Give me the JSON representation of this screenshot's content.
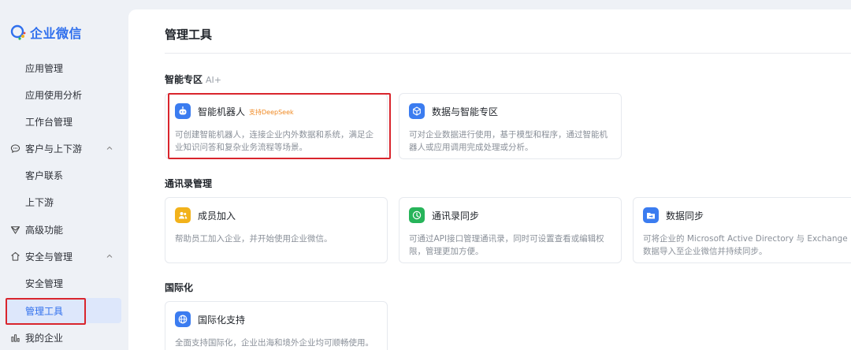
{
  "brand": {
    "name": "企业微信"
  },
  "sidebar": {
    "items": [
      {
        "label": "应用管理"
      },
      {
        "label": "应用使用分析"
      },
      {
        "label": "工作台管理"
      },
      {
        "label": "客户与上下游"
      },
      {
        "label": "客户联系"
      },
      {
        "label": "上下游"
      },
      {
        "label": "高级功能"
      },
      {
        "label": "安全与管理"
      },
      {
        "label": "安全管理"
      },
      {
        "label": "管理工具"
      },
      {
        "label": "我的企业"
      }
    ]
  },
  "main": {
    "title": "管理工具",
    "sections": [
      {
        "title": "智能专区",
        "tag": "AI+",
        "cards": [
          {
            "title": "智能机器人",
            "badge": "支持DeepSeek",
            "desc": "可创建智能机器人，连接企业内外数据和系统，满足企业知识问答和复杂业务流程等场景。",
            "icon": "robot-icon"
          },
          {
            "title": "数据与智能专区",
            "desc": "可对企业数据进行使用，基于模型和程序，通过智能机器人或应用调用完成处理或分析。",
            "icon": "data-cube-icon"
          }
        ]
      },
      {
        "title": "通讯录管理",
        "cards": [
          {
            "title": "成员加入",
            "desc": "帮助员工加入企业，并开始使用企业微信。",
            "icon": "members-icon"
          },
          {
            "title": "通讯录同步",
            "desc": "可通过API接口管理通讯录，同时可设置查看或编辑权限，管理更加方便。",
            "icon": "sync-icon"
          },
          {
            "title": "数据同步",
            "desc": "可将企业的 Microsoft Active Directory 与 Exchange 数据导入至企业微信并持续同步。",
            "icon": "folder-sync-icon"
          }
        ]
      },
      {
        "title": "国际化",
        "cards": [
          {
            "title": "国际化支持",
            "desc": "全面支持国际化，企业出海和境外企业均可顺畅使用。",
            "icon": "globe-icon"
          }
        ]
      }
    ]
  },
  "colors": {
    "accent": "#2f6fed",
    "highlight_border": "#d9252d",
    "badge": "#f08a24"
  }
}
